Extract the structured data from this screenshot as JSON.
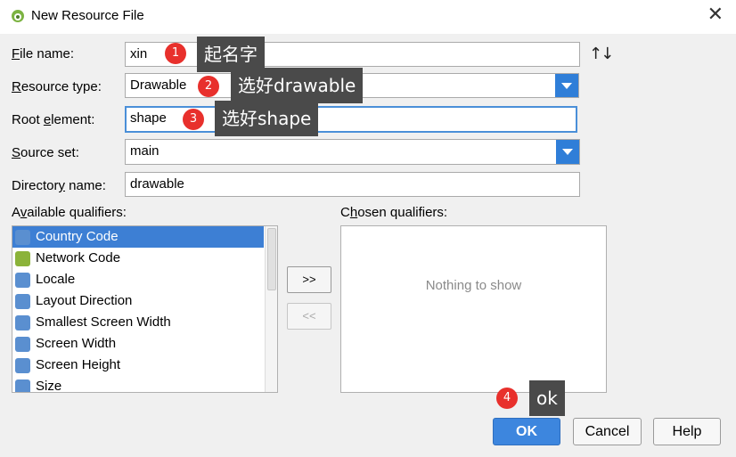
{
  "window": {
    "title": "New Resource File",
    "close_glyph": "✕"
  },
  "form": {
    "file_name": {
      "label_underline": "F",
      "label_rest": "ile name:",
      "value": "xin"
    },
    "resource_type": {
      "label_underline": "R",
      "label_rest": "esource type:",
      "value": "Drawable"
    },
    "root_element": {
      "label_pre": "Root ",
      "label_underline": "e",
      "label_rest": "lement:",
      "value": "shape"
    },
    "source_set": {
      "label_underline": "S",
      "label_rest": "ource set:",
      "value": "main"
    },
    "directory_name": {
      "label_pre": "Director",
      "label_underline": "y",
      "label_rest": " name:",
      "value": "drawable"
    }
  },
  "sort_glyph": "↑↓",
  "available": {
    "label_pre": "A",
    "label_underline": "v",
    "label_rest": "ailable qualifiers:",
    "items": [
      {
        "label": "Country Code",
        "icon": "globe-icon",
        "color": "#5a8fd0"
      },
      {
        "label": "Network Code",
        "icon": "android-icon",
        "color": "#8bb33a"
      },
      {
        "label": "Locale",
        "icon": "globe-icon",
        "color": "#5a8fd0"
      },
      {
        "label": "Layout Direction",
        "icon": "layout-direction-icon",
        "color": "#5a8fd0"
      },
      {
        "label": "Smallest Screen Width",
        "icon": "screen-width-icon",
        "color": "#5a8fd0"
      },
      {
        "label": "Screen Width",
        "icon": "screen-width-icon",
        "color": "#5a8fd0"
      },
      {
        "label": "Screen Height",
        "icon": "screen-height-icon",
        "color": "#5a8fd0"
      },
      {
        "label": "Size",
        "icon": "size-icon",
        "color": "#5a8fd0"
      }
    ],
    "selected_index": 0
  },
  "chosen": {
    "label_pre": "C",
    "label_underline": "h",
    "label_rest": "osen qualifiers:",
    "empty_text": "Nothing to show"
  },
  "buttons": {
    "add": ">>",
    "remove": "<<",
    "ok": "OK",
    "cancel": "Cancel",
    "help": "Help"
  },
  "annotations": [
    {
      "number": "1",
      "text": "起名字"
    },
    {
      "number": "2",
      "text": "选好drawable"
    },
    {
      "number": "3",
      "text": "选好shape"
    },
    {
      "number": "4",
      "text": "ok"
    }
  ],
  "colors": {
    "accent": "#3d86de",
    "selection": "#3d7fd4",
    "annotation_badge": "#e8302c",
    "annotation_label": "#4a4a4a"
  }
}
